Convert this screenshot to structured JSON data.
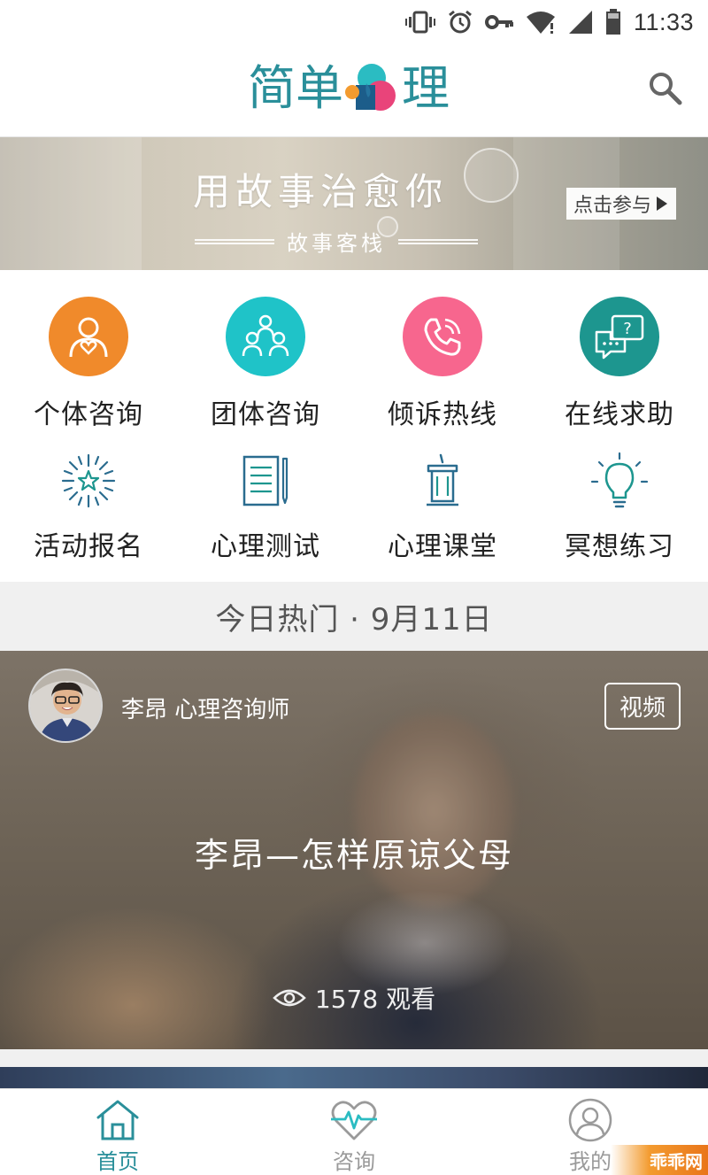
{
  "status_bar": {
    "time": "11:33"
  },
  "header": {
    "logo_char_1": "简",
    "logo_char_2": "单",
    "logo_char_3": "理",
    "brand_colors": {
      "teal": "#2a8f9a",
      "orange": "#f39b2f",
      "cyan": "#2bbcc2",
      "pink": "#e9447a"
    }
  },
  "banner": {
    "title": "用故事治愈你",
    "subtitle": "故事客栈",
    "cta_label": "点击参与"
  },
  "services": [
    {
      "label": "个体咨询",
      "icon": "person-heart-icon",
      "color": "#f08a2b"
    },
    {
      "label": "团体咨询",
      "icon": "group-icon",
      "color": "#1fc3c8"
    },
    {
      "label": "倾诉热线",
      "icon": "phone-icon",
      "color": "#f7668e"
    },
    {
      "label": "在线求助",
      "icon": "chat-question-icon",
      "color": "#1d968f"
    },
    {
      "label": "活动报名",
      "icon": "fireworks-icon"
    },
    {
      "label": "心理测试",
      "icon": "document-pen-icon"
    },
    {
      "label": "心理课堂",
      "icon": "podium-icon"
    },
    {
      "label": "冥想练习",
      "icon": "lightbulb-icon"
    }
  ],
  "hot": {
    "heading": "今日热门 · 9月11日"
  },
  "featured": {
    "author": "李昂 心理咨询师",
    "tag": "视频",
    "title": "李昂—怎样原谅父母",
    "views": "1578 观看"
  },
  "tabbar": {
    "tabs": [
      {
        "label": "首页",
        "active": true
      },
      {
        "label": "咨询",
        "active": false
      },
      {
        "label": "我的",
        "active": false
      }
    ],
    "active_color": "#2a8f9a",
    "inactive_color": "#9a9a9a"
  },
  "watermark": "乖乖网"
}
